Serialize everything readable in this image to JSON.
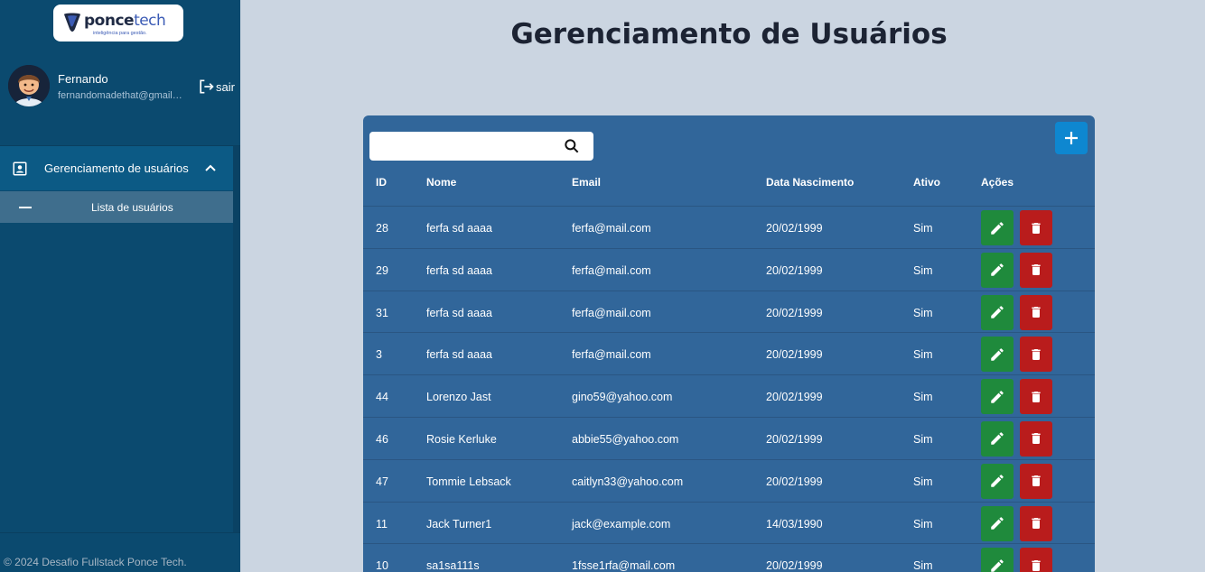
{
  "sidebar": {
    "logo": {
      "name_part1": "ponce",
      "name_part2": "tech",
      "tagline": "inteligência para gestão."
    },
    "user": {
      "name": "Fernando",
      "email": "fernandomadethat@gmail.com"
    },
    "logout_label": "sair",
    "menu": {
      "group_label": "Gerenciamento de usuários",
      "sub_label": "Lista de usuários"
    },
    "footer": "© 2024 Desafio Fullstack Ponce Tech."
  },
  "main": {
    "title": "Gerenciamento de Usuários",
    "search": {
      "placeholder": "",
      "value": ""
    },
    "columns": [
      "ID",
      "Nome",
      "Email",
      "Data Nascimento",
      "Ativo",
      "Ações"
    ],
    "rows": [
      {
        "id": "28",
        "nome": "ferfa sd aaaa",
        "email": "ferfa@mail.com",
        "nascimento": "20/02/1999",
        "ativo": "Sim"
      },
      {
        "id": "29",
        "nome": "ferfa sd aaaa",
        "email": "ferfa@mail.com",
        "nascimento": "20/02/1999",
        "ativo": "Sim"
      },
      {
        "id": "31",
        "nome": "ferfa sd aaaa",
        "email": "ferfa@mail.com",
        "nascimento": "20/02/1999",
        "ativo": "Sim"
      },
      {
        "id": "3",
        "nome": "ferfa sd aaaa",
        "email": "ferfa@mail.com",
        "nascimento": "20/02/1999",
        "ativo": "Sim"
      },
      {
        "id": "44",
        "nome": "Lorenzo Jast",
        "email": "gino59@yahoo.com",
        "nascimento": "20/02/1999",
        "ativo": "Sim"
      },
      {
        "id": "46",
        "nome": "Rosie Kerluke",
        "email": "abbie55@yahoo.com",
        "nascimento": "20/02/1999",
        "ativo": "Sim"
      },
      {
        "id": "47",
        "nome": "Tommie Lebsack",
        "email": "caitlyn33@yahoo.com",
        "nascimento": "20/02/1999",
        "ativo": "Sim"
      },
      {
        "id": "11",
        "nome": "Jack Turner1",
        "email": "jack@example.com",
        "nascimento": "14/03/1990",
        "ativo": "Sim"
      },
      {
        "id": "10",
        "nome": "sa1sa111s",
        "email": "1fsse1rfa@mail.com",
        "nascimento": "20/02/1999",
        "ativo": "Sim"
      }
    ]
  },
  "colors": {
    "sidebar_bg": "#0b4a6f",
    "card_bg": "#31669a",
    "edit": "#1f8a3c",
    "delete": "#b91c1c",
    "add": "#0e87d0"
  },
  "icons": {
    "logo": "ponce-logo-icon",
    "logout": "logout-icon",
    "menu_group": "contact-card-icon",
    "chevron": "chevron-up-icon",
    "search": "search-icon",
    "add": "plus-icon",
    "edit": "pencil-icon",
    "delete": "trash-icon"
  }
}
